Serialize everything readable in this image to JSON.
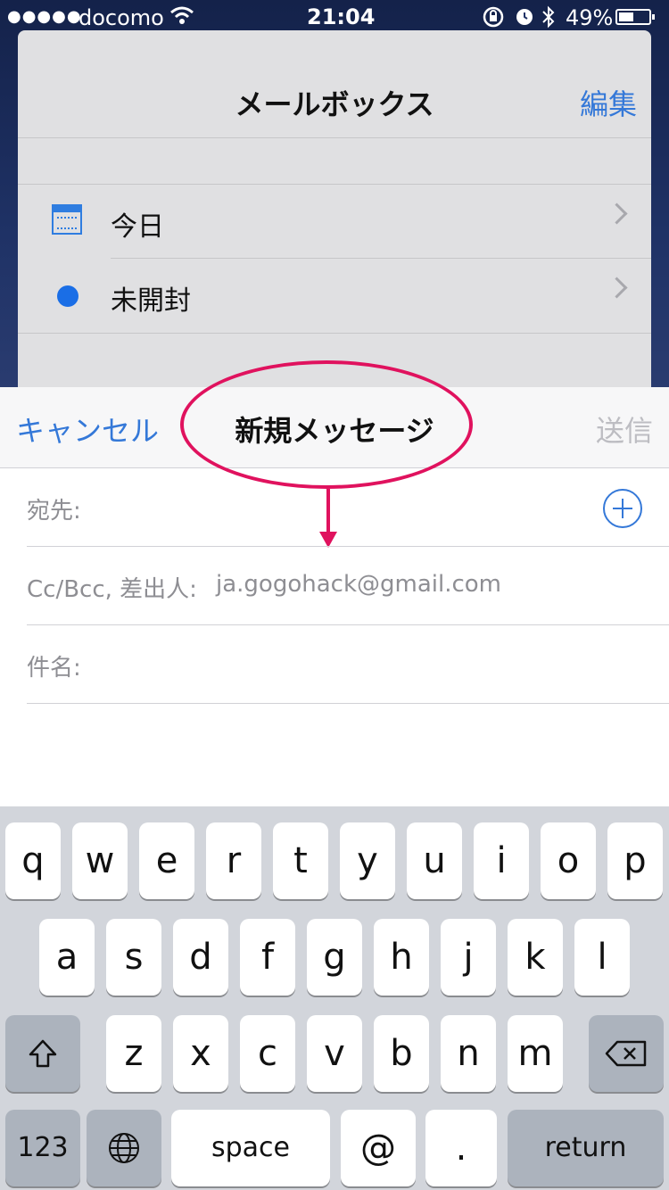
{
  "status_bar": {
    "signal": "●●●●●",
    "carrier": "docomo",
    "time": "21:04",
    "battery": "49%",
    "battery_level": 0.49
  },
  "mailbox": {
    "title": "メールボックス",
    "edit": "編集",
    "items": [
      {
        "label": "今日",
        "icon": "calendar-icon"
      },
      {
        "label": "未開封",
        "icon": "unread-dot-icon"
      }
    ]
  },
  "compose": {
    "cancel": "キャンセル",
    "title": "新規メッセージ",
    "send": "送信",
    "to_label": "宛先:",
    "ccbcc_label": "Cc/Bcc, 差出人:",
    "from_value": "ja.gogohack@gmail.com",
    "subject_label": "件名:"
  },
  "keyboard": {
    "row1": [
      "q",
      "w",
      "e",
      "r",
      "t",
      "y",
      "u",
      "i",
      "o",
      "p"
    ],
    "row2": [
      "a",
      "s",
      "d",
      "f",
      "g",
      "h",
      "j",
      "k",
      "l"
    ],
    "row3": [
      "z",
      "x",
      "c",
      "v",
      "b",
      "n",
      "m"
    ],
    "num": "123",
    "space": "space",
    "at": "@",
    "dot": ".",
    "return": "return"
  },
  "colors": {
    "accent": "#3478d8",
    "highlight": "#e0125e"
  }
}
